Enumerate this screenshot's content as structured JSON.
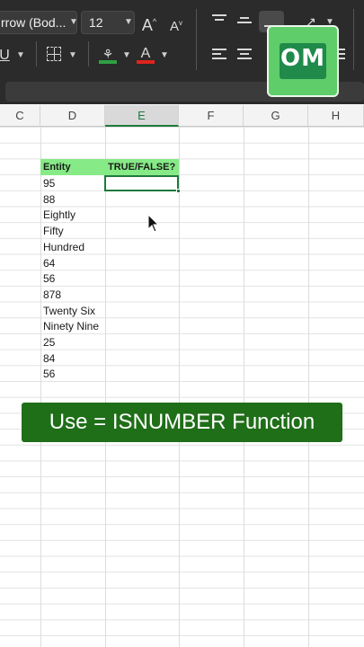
{
  "toolbar": {
    "font_name": "rrow (Bod...",
    "font_size": "12",
    "increase_font_glyph": "A",
    "decrease_font_glyph": "A",
    "underline_glyph": "U",
    "font_color_glyph": "A",
    "fill_color": "#2ea043",
    "font_color": "#e0231c"
  },
  "logo": {
    "text": "OM"
  },
  "columns": [
    {
      "label": "C",
      "active": false
    },
    {
      "label": "D",
      "active": false
    },
    {
      "label": "E",
      "active": true
    },
    {
      "label": "F",
      "active": false
    },
    {
      "label": "G",
      "active": false
    },
    {
      "label": "H",
      "active": false
    }
  ],
  "table": {
    "header_d": "Entity",
    "header_e": "TRUE/FALSE?",
    "entities": [
      "95",
      "88",
      "Eightly",
      "Fifty",
      "Hundred",
      "64",
      "56",
      "878",
      "Twenty Six",
      "Ninety Nine",
      "25",
      "84",
      "56"
    ]
  },
  "banner": {
    "text": "Use = ISNUMBER Function"
  },
  "colors": {
    "header_fill": "#86ea86",
    "selection": "#1e7a3c",
    "banner": "#1f6e18",
    "ribbon": "#2b2b2b"
  }
}
